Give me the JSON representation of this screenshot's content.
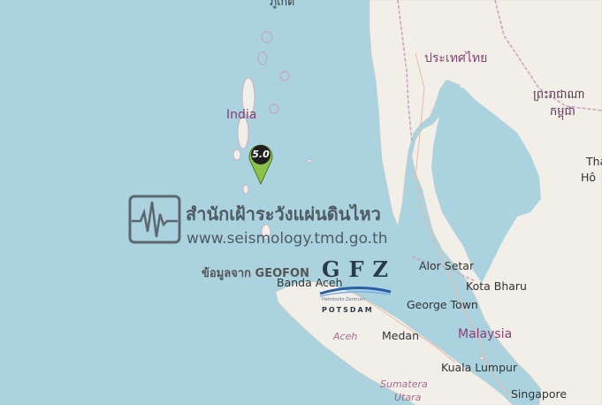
{
  "map": {
    "labels": {
      "top_partial": "ภูเก็ต",
      "thailand": "ประเทศไทย",
      "cambodia_line1": "ព្រះរាជាណា",
      "cambodia_line2": "កម្ពុជា",
      "india": "India",
      "thai_partial": "Tha",
      "ho_partial": "Hô",
      "alor_setar": "Alor Setar",
      "kota_bharu": "Kota Bharu",
      "banda_aceh": "Banda Aceh",
      "george_town": "George Town",
      "malaysia": "Malaysia",
      "aceh": "Aceh",
      "medan": "Medan",
      "kuala_lumpur": "Kuala Lumpur",
      "sumatera": "Sumatera",
      "utara": "Utara",
      "singapore": "Singapore"
    },
    "colors": {
      "water": "#aad3df",
      "land": "#f2efe9",
      "border": "#c7a6bf"
    }
  },
  "marker": {
    "magnitude": "5.0",
    "icon": "map-pin-icon",
    "color": "#8bc34a"
  },
  "watermark": {
    "title": "สำนักเฝ้าระวังแผ่นดินไหว",
    "url": "www.seismology.tmd.go.th",
    "source": "ข้อมูลจาก GEOFON",
    "logo_letters": "GFZ",
    "logo_sub": "Helmholtz-Zentrum",
    "logo_city": "POTSDAM"
  }
}
